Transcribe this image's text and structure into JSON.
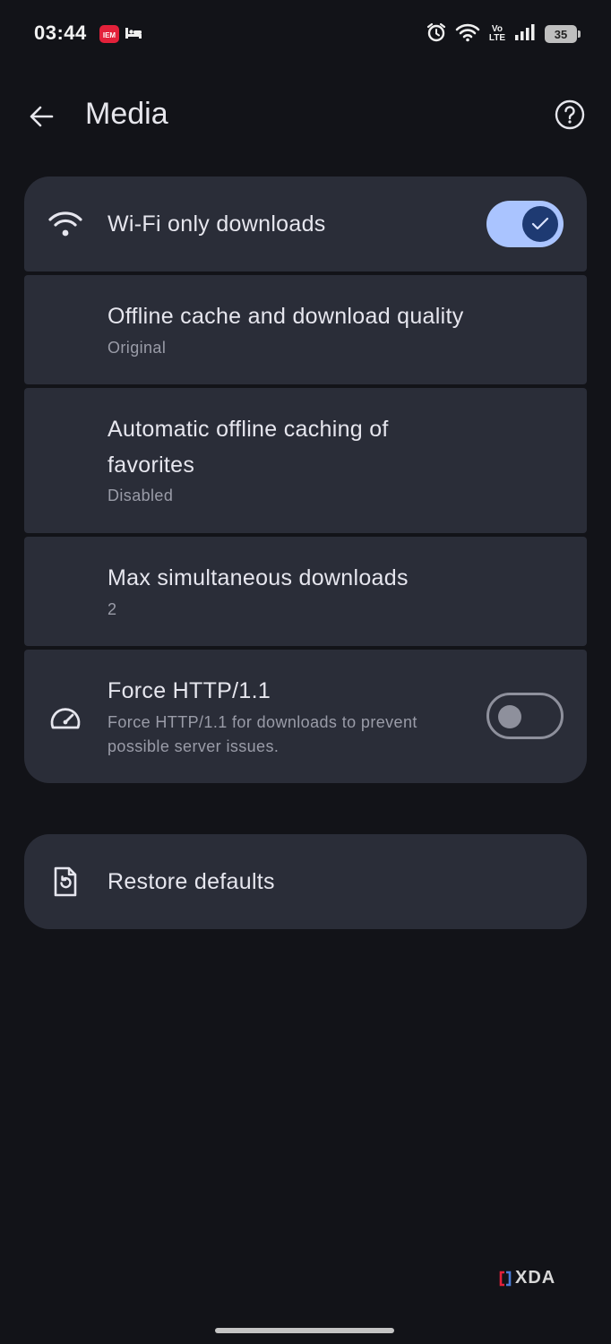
{
  "status_bar": {
    "time": "03:44",
    "notification_icons": [
      "app-notification-icon",
      "bed-icon"
    ],
    "system_icons": [
      "alarm-icon",
      "wifi-icon",
      "volte-icon",
      "signal-icon",
      "battery-icon"
    ],
    "volte_top": "Vo",
    "volte_bottom": "LTE",
    "battery_level": "35"
  },
  "app_bar": {
    "title": "Media",
    "back_icon": "arrow-left-icon",
    "help_icon": "help-circle-icon"
  },
  "settings": {
    "wifi_only": {
      "title": "Wi-Fi only downloads",
      "icon": "wifi-icon",
      "enabled": true
    },
    "cache_quality": {
      "title": "Offline cache and download quality",
      "subtitle": "Original"
    },
    "auto_cache": {
      "title_line1": "Automatic offline caching of",
      "title_line2": "favorites",
      "subtitle": "Disabled"
    },
    "max_downloads": {
      "title": "Max simultaneous downloads",
      "subtitle": "2"
    },
    "force_http": {
      "title": "Force HTTP/1.1",
      "subtitle_line1": "Force HTTP/1.1 for downloads to prevent",
      "subtitle_line2": "possible server issues.",
      "icon": "speedometer-icon",
      "enabled": false
    }
  },
  "restore": {
    "label": "Restore defaults",
    "icon": "restore-file-icon"
  },
  "watermark": "XDA",
  "colors": {
    "background": "#121318",
    "card": "#2a2d38",
    "toggle_on": "#aac4ff",
    "toggle_knob_on": "#1e3a72",
    "subtitle": "#9a9ca8"
  }
}
